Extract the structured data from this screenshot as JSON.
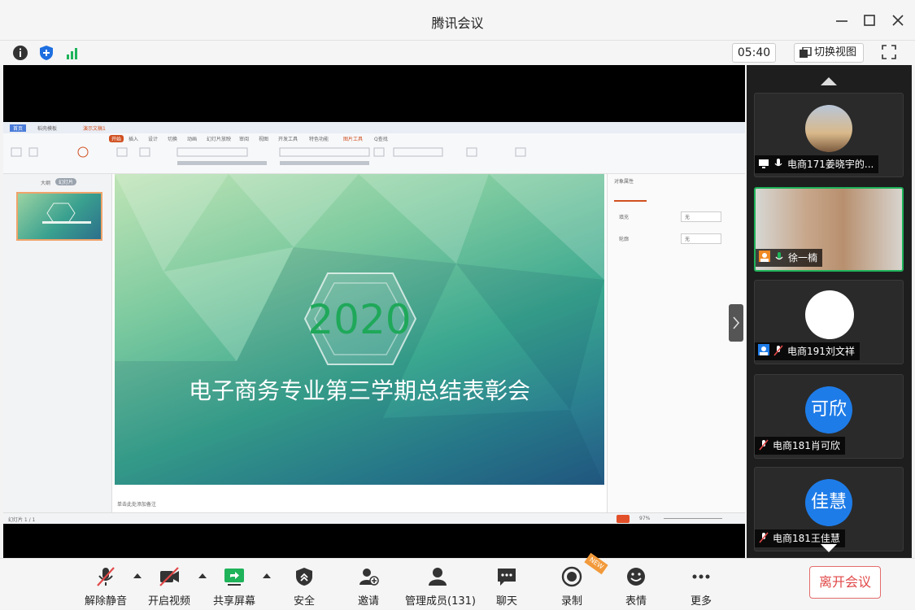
{
  "window": {
    "title": "腾讯会议"
  },
  "toolbar": {
    "timer": "05:40",
    "switch_view_label": "切换视图"
  },
  "presentation": {
    "slide_year": "2020",
    "slide_title": "电子商务专业第三学期总结表彰会",
    "tabs": [
      "首页",
      "稻壳模板",
      "演示文稿1"
    ],
    "ribbon_tabs": [
      "开始",
      "插入",
      "设计",
      "切换",
      "动画",
      "幻灯片放映",
      "审阅",
      "视图",
      "开发工具",
      "特色功能",
      "图片工具",
      "Q查找"
    ],
    "left_tabs": [
      "大纲",
      "幻灯片"
    ],
    "right_panel": {
      "title": "对象属性",
      "row1": "填充",
      "row2": "轮廓",
      "value": "无"
    },
    "status_left": "幻灯片 1 / 1",
    "notes_hint": "单击此处添加备注",
    "zoom": "97%"
  },
  "participants": [
    {
      "name": "电商171姜晓宇的...",
      "avatar_text": "",
      "type": "photo"
    },
    {
      "name": "徐一楠",
      "avatar_text": "",
      "type": "video"
    },
    {
      "name": "电商191刘文祥",
      "avatar_text": "",
      "type": "blank"
    },
    {
      "name": "电商181肖可欣",
      "avatar_text": "可欣",
      "type": "initials"
    },
    {
      "name": "电商181王佳慧",
      "avatar_text": "佳慧",
      "type": "initials"
    }
  ],
  "bottom": {
    "unmute": "解除静音",
    "video": "开启视频",
    "share": "共享屏幕",
    "security": "安全",
    "invite": "邀请",
    "members": "管理成员(131)",
    "chat": "聊天",
    "record": "录制",
    "reactions": "表情",
    "more": "更多",
    "leave": "离开会议",
    "new_badge": "NEW"
  },
  "colors": {
    "accent_green": "#1fb35a",
    "avatar_blue": "#1e7ce8",
    "leave_red": "#e14848"
  }
}
